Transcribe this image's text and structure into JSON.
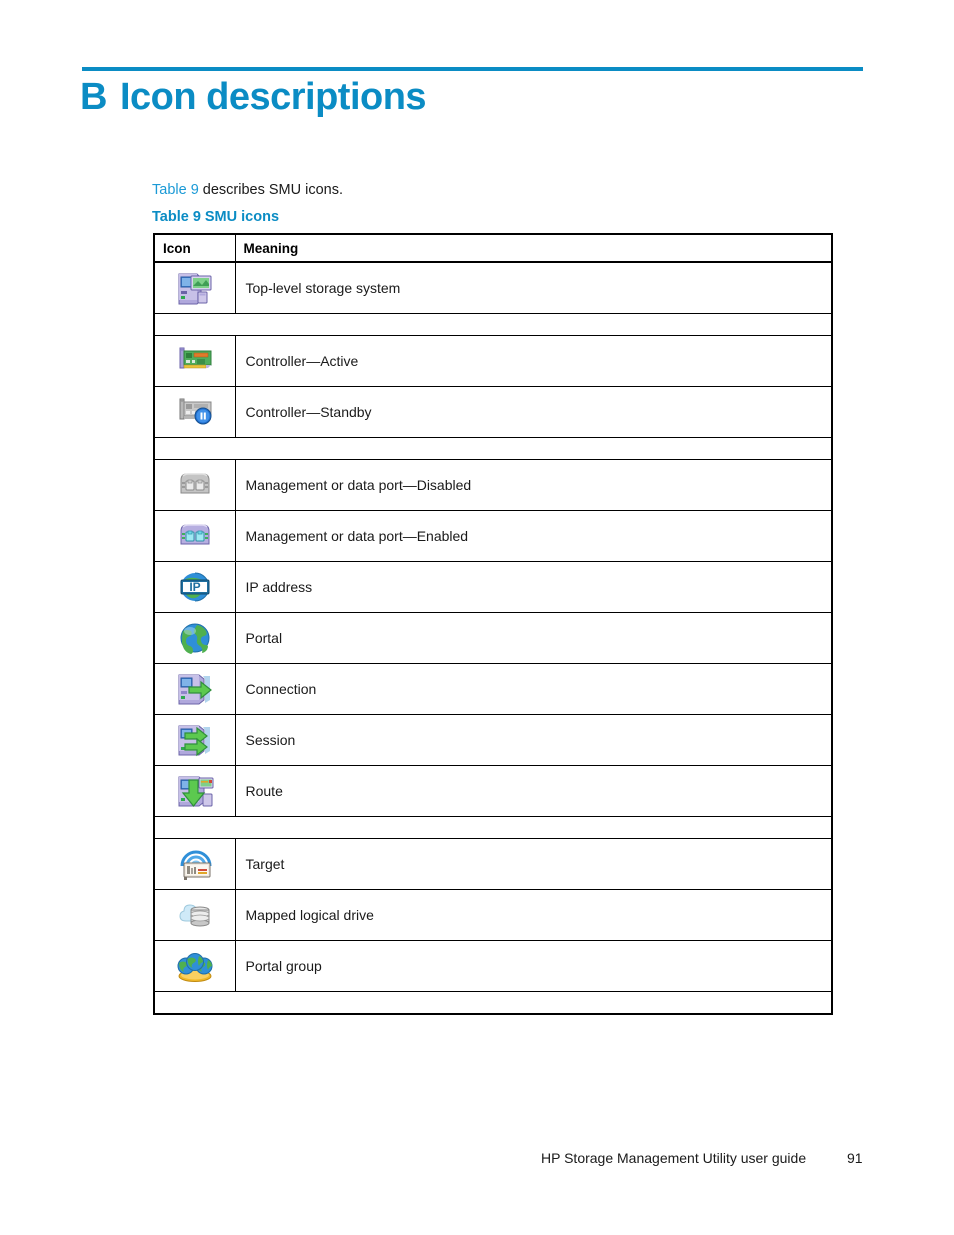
{
  "page": {
    "chapter_letter": "B",
    "chapter_title": "Icon descriptions",
    "accent_color": "#0b8cc4",
    "intro_xref": "Table 9",
    "intro_text": " describes SMU icons.",
    "caption_label": "Table 9",
    "caption_text": "SMU icons"
  },
  "table": {
    "headers": {
      "icon": "Icon",
      "meaning": "Meaning"
    },
    "rows": [
      {
        "kind": "data",
        "icon": "top-level-storage-system-icon",
        "meaning": "Top-level storage system"
      },
      {
        "kind": "spacer",
        "icon": "",
        "meaning": ""
      },
      {
        "kind": "data",
        "icon": "controller-active-icon",
        "meaning": "Controller—Active"
      },
      {
        "kind": "data",
        "icon": "controller-standby-icon",
        "meaning": "Controller—Standby"
      },
      {
        "kind": "spacer",
        "icon": "",
        "meaning": ""
      },
      {
        "kind": "data",
        "icon": "port-disabled-icon",
        "meaning": "Management or data port—Disabled"
      },
      {
        "kind": "data",
        "icon": "port-enabled-icon",
        "meaning": "Management or data port—Enabled"
      },
      {
        "kind": "data",
        "icon": "ip-address-icon",
        "meaning": "IP address"
      },
      {
        "kind": "data",
        "icon": "portal-icon",
        "meaning": "Portal"
      },
      {
        "kind": "data",
        "icon": "connection-icon",
        "meaning": "Connection"
      },
      {
        "kind": "data",
        "icon": "session-icon",
        "meaning": "Session"
      },
      {
        "kind": "data",
        "icon": "route-icon",
        "meaning": "Route"
      },
      {
        "kind": "spacer",
        "icon": "",
        "meaning": ""
      },
      {
        "kind": "data",
        "icon": "target-icon",
        "meaning": "Target"
      },
      {
        "kind": "data",
        "icon": "mapped-logical-drive-icon",
        "meaning": "Mapped logical drive"
      },
      {
        "kind": "data",
        "icon": "portal-group-icon",
        "meaning": "Portal group"
      },
      {
        "kind": "spacer",
        "icon": "",
        "meaning": ""
      }
    ]
  },
  "footer": {
    "guide_title": "HP Storage Management Utility user guide",
    "page_number": "91"
  }
}
